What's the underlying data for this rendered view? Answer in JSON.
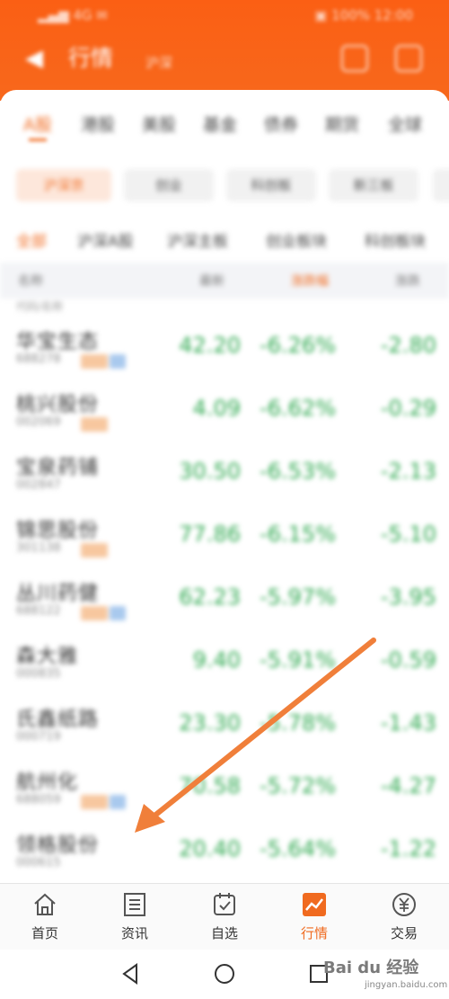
{
  "status_bar": {
    "left": "▂▄▆ 4G ✉",
    "right": "▣ 100% 12:00"
  },
  "header": {
    "back_icon": "arrow-left-icon",
    "title": "行情",
    "subtitle": "沪深"
  },
  "market_tabs": [
    {
      "label": "A股",
      "active": true
    },
    {
      "label": "港股",
      "active": false
    },
    {
      "label": "美股",
      "active": false
    },
    {
      "label": "基金",
      "active": false
    },
    {
      "label": "债券",
      "active": false
    },
    {
      "label": "期货",
      "active": false
    },
    {
      "label": "全球",
      "active": false
    }
  ],
  "filter_pills": [
    {
      "label": "沪深京",
      "active": true
    },
    {
      "label": "创业",
      "active": false
    },
    {
      "label": "科创板",
      "active": false
    },
    {
      "label": "新三板",
      "active": false
    }
  ],
  "sub_tabs": [
    {
      "label": "全部",
      "active": true
    },
    {
      "label": "沪深A股",
      "active": false
    },
    {
      "label": "沪深主板",
      "active": false
    },
    {
      "label": "创业板块",
      "active": false
    },
    {
      "label": "科创板块",
      "active": false
    }
  ],
  "columns": {
    "name": "名称",
    "price": "最新",
    "pct": "涨跌幅",
    "chg": "涨跌"
  },
  "subheader": "代码/名称",
  "stocks": [
    {
      "name": "华宝生态",
      "code": "688278",
      "price": "42.20",
      "pct": "-6.26%",
      "chg": "-2.80",
      "tags": 2
    },
    {
      "name": "桃兴股份",
      "code": "002069",
      "price": "4.09",
      "pct": "-6.62%",
      "chg": "-0.29",
      "tags": 1
    },
    {
      "name": "宝泉药铺",
      "code": "002847",
      "price": "30.50",
      "pct": "-6.53%",
      "chg": "-2.13",
      "tags": 0
    },
    {
      "name": "锦思股份",
      "code": "301138",
      "price": "77.86",
      "pct": "-6.15%",
      "chg": "-5.10",
      "tags": 1
    },
    {
      "name": "丛川药健",
      "code": "688122",
      "price": "62.23",
      "pct": "-5.97%",
      "chg": "-3.95",
      "tags": 2
    },
    {
      "name": "森大雅",
      "code": "000835",
      "price": "9.40",
      "pct": "-5.91%",
      "chg": "-0.59",
      "tags": 0
    },
    {
      "name": "氏鑫纸路",
      "code": "000719",
      "price": "23.30",
      "pct": "-5.78%",
      "chg": "-1.43",
      "tags": 0
    },
    {
      "name": "航州化",
      "code": "688059",
      "price": "70.58",
      "pct": "-5.72%",
      "chg": "-4.27",
      "tags": 2
    },
    {
      "name": "领格股份",
      "code": "000615",
      "price": "20.40",
      "pct": "-5.64%",
      "chg": "-1.22",
      "tags": 0
    }
  ],
  "bottom_nav": [
    {
      "label": "首页",
      "icon": "home-icon",
      "active": false
    },
    {
      "label": "资讯",
      "icon": "news-icon",
      "active": false
    },
    {
      "label": "自选",
      "icon": "watchlist-icon",
      "active": false
    },
    {
      "label": "行情",
      "icon": "market-chart-icon",
      "active": true
    },
    {
      "label": "交易",
      "icon": "yen-trade-icon",
      "active": false
    }
  ],
  "system_nav": [
    "back-triangle-icon",
    "home-circle-icon",
    "recents-square-icon"
  ],
  "watermark": {
    "logo": "Bai du 经验",
    "url": "jingyan.baidu.com"
  },
  "colors": {
    "brand": "#f96415",
    "accent": "#f06a1f",
    "down": "#2ea84f"
  }
}
